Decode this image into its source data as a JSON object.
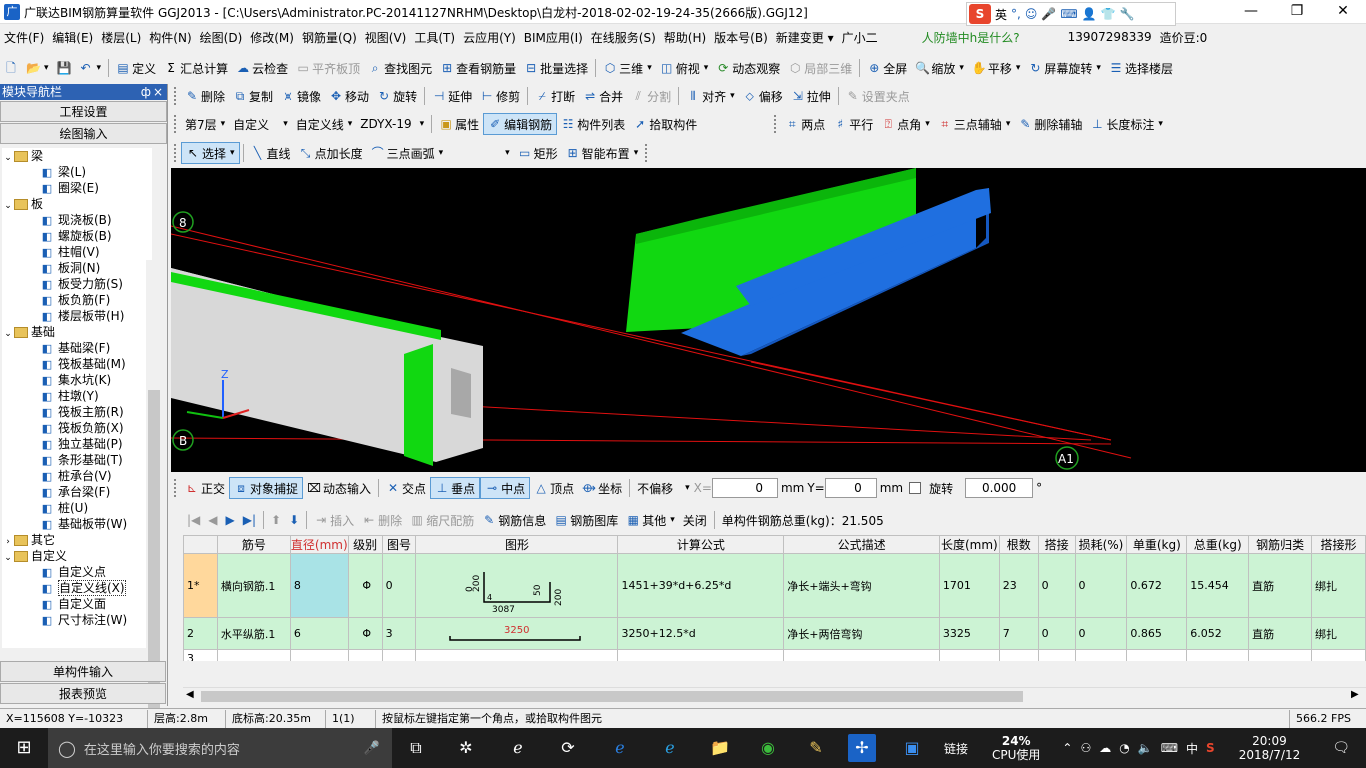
{
  "window": {
    "title": "广联达BIM钢筋算量软件 GGJ2013 - [C:\\Users\\Administrator.PC-20141127NRHM\\Desktop\\白龙村-2018-02-02-19-24-35(2666版).GGJ12]",
    "minimize": "—",
    "maximize": "❐",
    "close": "✕"
  },
  "ime": {
    "logo": "S",
    "lang": "英"
  },
  "menu": {
    "items": [
      "文件(F)",
      "编辑(E)",
      "楼层(L)",
      "构件(N)",
      "绘图(D)",
      "修改(M)",
      "钢筋量(Q)",
      "视图(V)",
      "工具(T)",
      "云应用(Y)",
      "BIM应用(I)",
      "在线服务(S)",
      "帮助(H)",
      "版本号(B)",
      "新建变更 ▾",
      "广小二"
    ],
    "notice": "人防墙中h是什么?",
    "phone": "13907298339",
    "beans": "造价豆:0"
  },
  "toolbar1": {
    "define": "定义",
    "sum": "汇总计算",
    "cloud_check": "云检查",
    "flat_board": "平齐板顶",
    "find": "查找图元",
    "view_rebar": "查看钢筋量",
    "batch_select": "批量选择",
    "view_3d": "三维",
    "top_view": "俯视",
    "dyn_observe": "动态观察",
    "local_3d": "局部三维",
    "fullscreen": "全屏",
    "zoom": "缩放",
    "pan": "平移",
    "screen_rotate": "屏幕旋转",
    "select_floor": "选择楼层"
  },
  "toolbar2": {
    "delete": "删除",
    "copy": "复制",
    "mirror": "镜像",
    "move": "移动",
    "rotate": "旋转",
    "extend": "延伸",
    "trim": "修剪",
    "break": "打断",
    "merge": "合并",
    "split": "分割",
    "align": "对齐",
    "offset": "偏移",
    "stretch": "拉伸",
    "set_grip": "设置夹点"
  },
  "toolbar3": {
    "floor": "第7层",
    "category": "自定义",
    "type": "自定义线",
    "component": "ZDYX-19",
    "attributes": "属性",
    "edit_rebar": "编辑钢筋",
    "component_list": "构件列表",
    "pick_component": "拾取构件",
    "two_points": "两点",
    "parallel": "平行",
    "point_angle": "点角",
    "three_point_axis": "三点辅轴",
    "delete_axis": "删除辅轴",
    "length_dim": "长度标注"
  },
  "toolbar4": {
    "select": "选择",
    "line": "直线",
    "point_length": "点加长度",
    "three_point_arc": "三点画弧",
    "rect": "矩形",
    "smart_layout": "智能布置"
  },
  "nav": {
    "title": "模块导航栏",
    "pin": "ф",
    "close": "×",
    "project_settings": "工程设置",
    "drawing_input": "绘图输入",
    "single_input": "单构件输入",
    "report_preview": "报表预览",
    "tree": [
      {
        "label": "梁",
        "type": "group"
      },
      {
        "label": "梁(L)",
        "icon": "beam-icon"
      },
      {
        "label": "圈梁(E)",
        "icon": "ring-beam-icon"
      },
      {
        "label": "板",
        "type": "group"
      },
      {
        "label": "现浇板(B)",
        "icon": "slab-icon"
      },
      {
        "label": "螺旋板(B)",
        "icon": "spiral-slab-icon"
      },
      {
        "label": "柱帽(V)",
        "icon": "column-cap-icon"
      },
      {
        "label": "板洞(N)",
        "icon": "slab-hole-icon"
      },
      {
        "label": "板受力筋(S)",
        "icon": "slab-rebar-icon"
      },
      {
        "label": "板负筋(F)",
        "icon": "slab-neg-rebar-icon"
      },
      {
        "label": "楼层板带(H)",
        "icon": "floor-strip-icon"
      },
      {
        "label": "基础",
        "type": "group"
      },
      {
        "label": "基础梁(F)",
        "icon": "foundation-beam-icon"
      },
      {
        "label": "筏板基础(M)",
        "icon": "raft-icon"
      },
      {
        "label": "集水坑(K)",
        "icon": "sump-icon"
      },
      {
        "label": "柱墩(Y)",
        "icon": "column-pier-icon"
      },
      {
        "label": "筏板主筋(R)",
        "icon": "raft-main-rebar-icon"
      },
      {
        "label": "筏板负筋(X)",
        "icon": "raft-neg-rebar-icon"
      },
      {
        "label": "独立基础(P)",
        "icon": "isolated-footing-icon"
      },
      {
        "label": "条形基础(T)",
        "icon": "strip-footing-icon"
      },
      {
        "label": "桩承台(V)",
        "icon": "pile-cap-icon"
      },
      {
        "label": "承台梁(F)",
        "icon": "cap-beam-icon"
      },
      {
        "label": "桩(U)",
        "icon": "pile-icon"
      },
      {
        "label": "基础板带(W)",
        "icon": "foundation-strip-icon"
      },
      {
        "label": "其它",
        "type": "group-collapsed"
      },
      {
        "label": "自定义",
        "type": "group"
      },
      {
        "label": "自定义点",
        "icon": "custom-point-icon"
      },
      {
        "label": "自定义线(X)",
        "icon": "custom-line-icon",
        "selected": true
      },
      {
        "label": "自定义面",
        "icon": "custom-face-icon"
      },
      {
        "label": "尺寸标注(W)",
        "icon": "dimension-icon"
      }
    ]
  },
  "viewport": {
    "axis_labels": [
      "8",
      "B",
      "A1"
    ],
    "axis_z": "Z",
    "bg": "#000000",
    "green": "#11d811",
    "blue": "#1f6fe0",
    "grey": "#d8d8d8",
    "red_line": "#e01010"
  },
  "snap": {
    "ortho": "正交",
    "object_snap": "对象捕捉",
    "dynamic_input": "动态输入",
    "intersection": "交点",
    "perpendicular": "垂点",
    "midpoint": "中点",
    "vertex": "顶点",
    "coords": "坐标",
    "no_offset": "不偏移",
    "x_label": "X=",
    "x_value": "0",
    "y_label": "Y=",
    "y_value": "0",
    "mm1": "mm",
    "mm2": "mm",
    "rotate": "旋转",
    "rotate_value": "0.000",
    "degree": "°"
  },
  "rebar_toolbar": {
    "insert": "插入",
    "delete": "删除",
    "scale": "缩尺配筋",
    "info": "钢筋信息",
    "library": "钢筋图库",
    "other": "其他",
    "close": "关闭",
    "total": "单构件钢筋总重(kg)：21.505"
  },
  "grid": {
    "headers": [
      "",
      "筋号",
      "直径(mm)",
      "级别",
      "图号",
      "图形",
      "计算公式",
      "公式描述",
      "长度(mm)",
      "根数",
      "搭接",
      "损耗(%)",
      "单重(kg)",
      "总重(kg)",
      "钢筋归类",
      "搭接形"
    ],
    "rows": [
      {
        "rn": "1*",
        "name": "横向钢筋.1",
        "dia": "8",
        "grade": "Φ",
        "fig": "0",
        "formula": "1451+39*d+6.25*d",
        "desc": "净长+端头+弯钩",
        "length": "1701",
        "count": "23",
        "lap": "0",
        "loss": "0",
        "unit_w": "0.672",
        "total_w": "15.454",
        "category": "直筋",
        "lap_type": "绑扎",
        "shape_labels": {
          "l1": "0",
          "l2": "200",
          "l3": "50",
          "l4": "200",
          "l5": "3087",
          "l6": "4"
        }
      },
      {
        "rn": "2",
        "name": "水平纵筋.1",
        "dia": "6",
        "grade": "Φ",
        "fig": "3",
        "formula": "3250+12.5*d",
        "desc": "净长+两倍弯钩",
        "length": "3325",
        "count": "7",
        "lap": "0",
        "loss": "0",
        "unit_w": "0.865",
        "total_w": "6.052",
        "category": "直筋",
        "lap_type": "绑扎",
        "shape_labels": {
          "l1": "3250"
        }
      },
      {
        "rn": "3"
      }
    ]
  },
  "status": {
    "coords": "X=115608 Y=-10323",
    "floor_height": "层高:2.8m",
    "base_height": "底标高:20.35m",
    "count": "1(1)",
    "hint": "按鼠标左键指定第一个角点，或拾取构件图元",
    "fps": "566.2 FPS"
  },
  "taskbar": {
    "search_placeholder": "在这里输入你要搜索的内容",
    "cpu": "24%",
    "cpu_label": "CPU使用",
    "link": "链接",
    "ime": "中",
    "time": "20:09",
    "date": "2018/7/12"
  }
}
